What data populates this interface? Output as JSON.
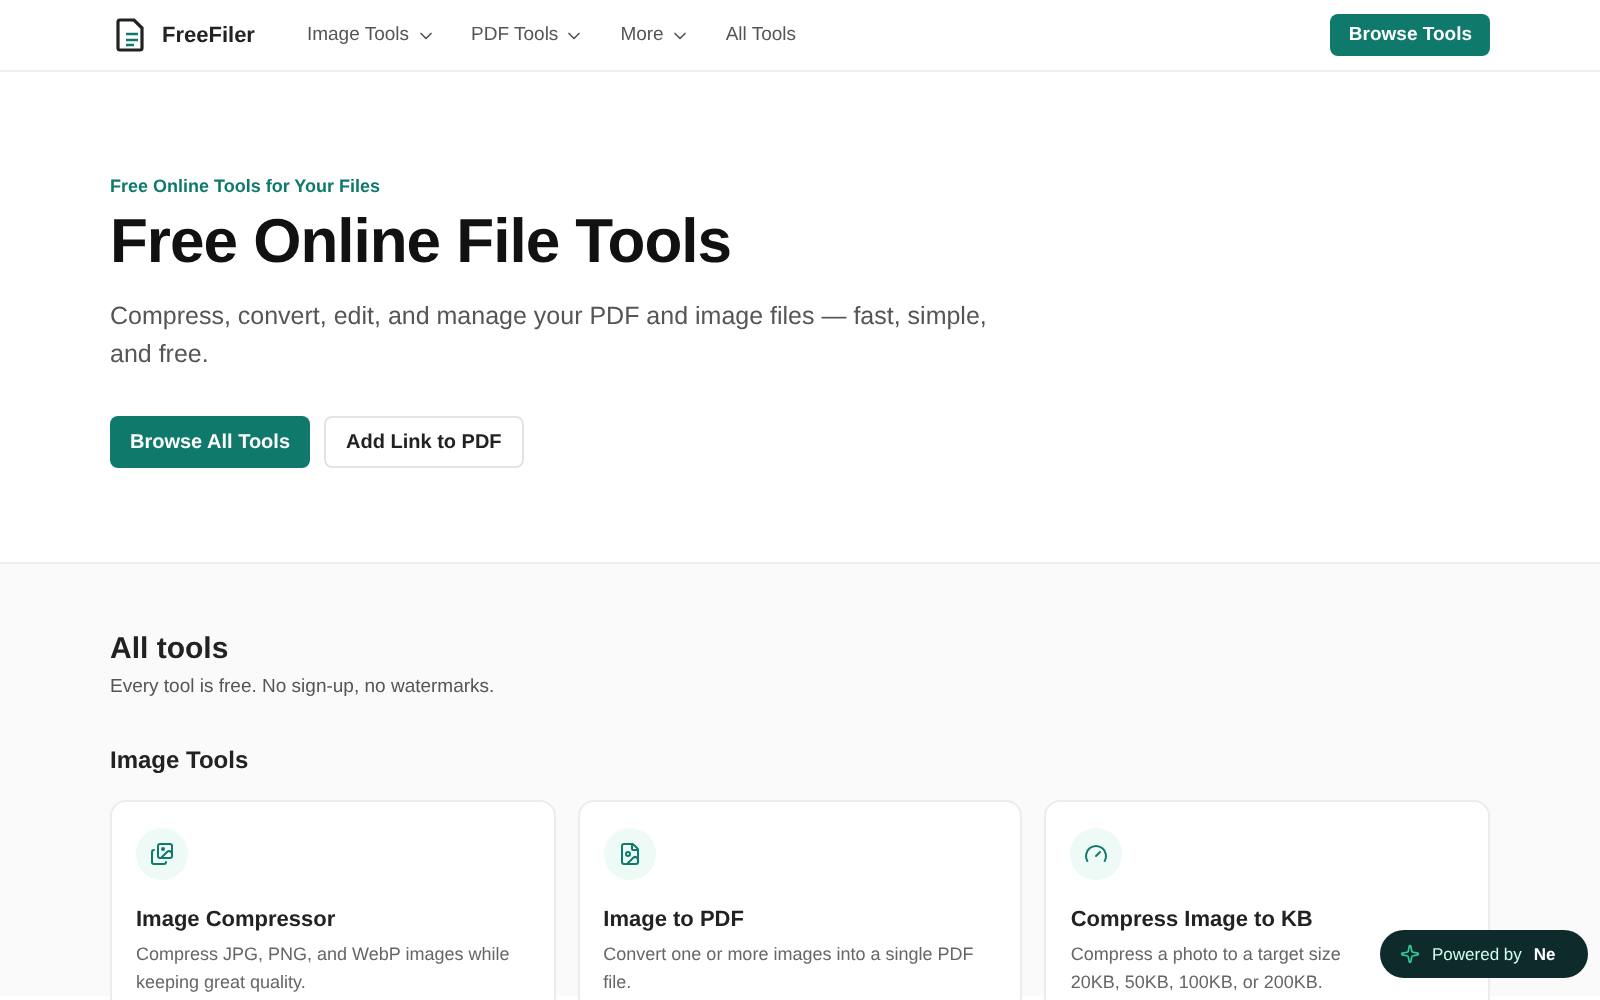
{
  "header": {
    "brand": "FreeFiler",
    "nav": [
      {
        "label": "Image Tools",
        "dropdown": true
      },
      {
        "label": "PDF Tools",
        "dropdown": true
      },
      {
        "label": "More",
        "dropdown": true
      },
      {
        "label": "All Tools",
        "dropdown": false
      }
    ],
    "cta": "Browse Tools"
  },
  "hero": {
    "eyebrow": "Free Online Tools for Your Files",
    "title": "Free Online File Tools",
    "subtitle": "Compress, convert, edit, and manage your PDF and image files — fast, simple, and free.",
    "buttons": [
      {
        "label": "Browse All Tools",
        "kind": "primary"
      },
      {
        "label": "Add Link to PDF",
        "kind": "secondary"
      }
    ]
  },
  "tools": {
    "title": "All tools",
    "subtitle": "Every tool is free. No sign-up, no watermarks.",
    "group": "Image Tools",
    "cards": [
      {
        "title": "Image Compressor",
        "description": "Compress JPG, PNG, and WebP images while keeping great quality."
      },
      {
        "title": "Image to PDF",
        "description": "Convert one or more images into a single PDF file."
      },
      {
        "title": "Compress Image to KB",
        "description": "Compress a photo to a target size 20KB, 50KB, 100KB, or 200KB."
      }
    ]
  },
  "badge": {
    "label": "Powered by",
    "brand": "Ne"
  }
}
